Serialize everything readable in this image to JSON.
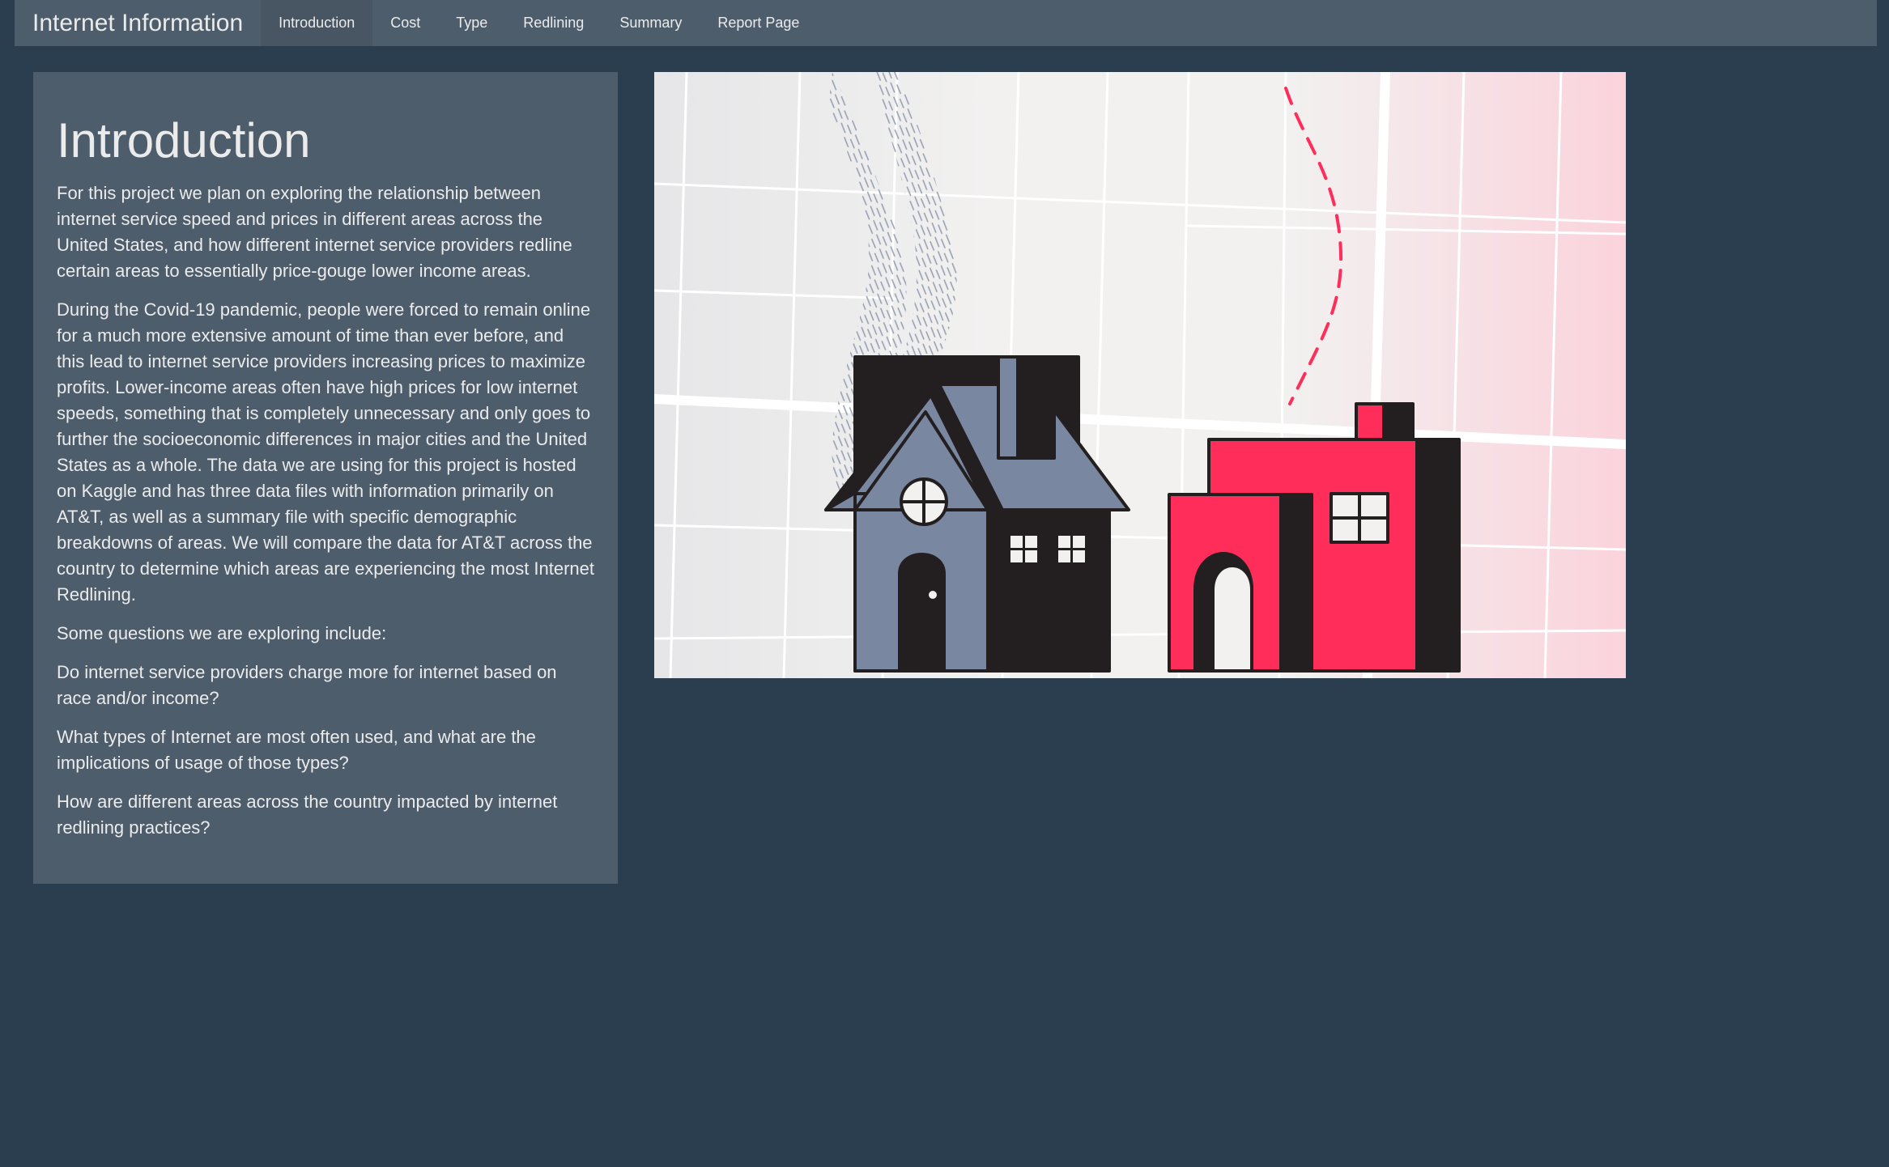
{
  "navbar": {
    "brand": "Internet Information",
    "items": [
      {
        "label": "Introduction",
        "active": true
      },
      {
        "label": "Cost",
        "active": false
      },
      {
        "label": "Type",
        "active": false
      },
      {
        "label": "Redlining",
        "active": false
      },
      {
        "label": "Summary",
        "active": false
      },
      {
        "label": "Report Page",
        "active": false
      }
    ]
  },
  "intro": {
    "title": "Introduction",
    "paragraphs": [
      "For this project we plan on exploring the relationship between internet service speed and prices in different areas across the United States, and how different internet service providers redline certain areas to essentially price-gouge lower income areas.",
      "During the Covid-19 pandemic, people were forced to remain online for a much more extensive amount of time than ever before, and this lead to internet service providers increasing prices to maximize profits. Lower-income areas often have high prices for low internet speeds, something that is completely unnecessary and only goes to further the socioeconomic differences in major cities and the United States as a whole. The data we are using for this project is hosted on Kaggle and has three data files with information primarily on AT&T, as well as a summary file with specific demographic breakdowns of areas. We will compare the data for AT&T across the country to determine which areas are experiencing the most Internet Redlining.",
      "Some questions we are exploring include:",
      "Do internet service providers charge more for internet based on race and/or income?",
      "What types of Internet are most often used, and what are the implications of usage of those types?",
      "How are different areas across the country impacted by internet redlining practices?"
    ]
  },
  "illustration": {
    "subject": "redlining-houses-illustration",
    "colors": {
      "background": "#f2f1f0",
      "grid": "#ffffff",
      "blue_house": "#7a87a1",
      "red_house": "#ff2d5a",
      "outline": "#231f20",
      "red_tint": "#fbd3dc",
      "scribble": "#8e98ad"
    }
  },
  "theme": {
    "page_bg": "#2b3e50",
    "panel_bg": "#4e5d6c",
    "text": "#ebebeb"
  }
}
